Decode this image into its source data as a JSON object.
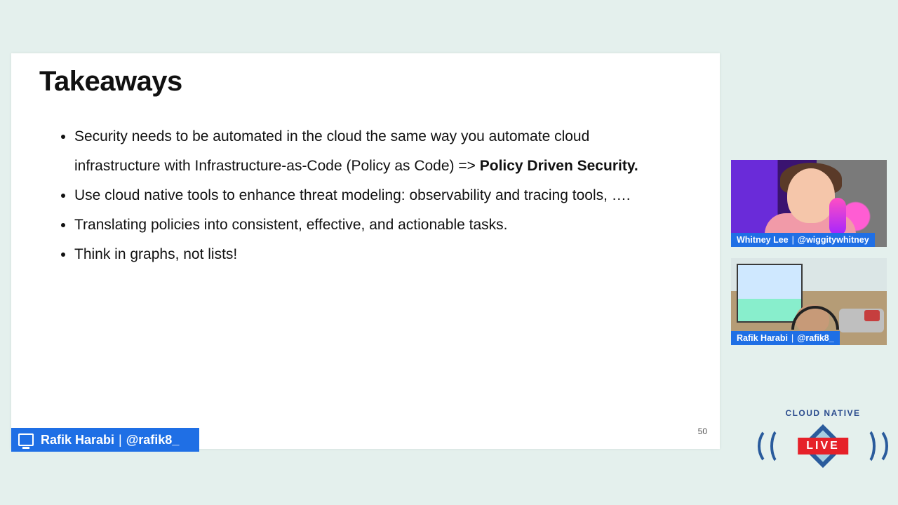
{
  "slide": {
    "title": "Takeaways",
    "bullet1_pre": "Security needs to be automated in the cloud the same way you automate cloud infrastructure with Infrastructure-as-Code (Policy as Code) => ",
    "bullet1_bold": "Policy Driven Security.",
    "bullet2": "Use cloud native tools to enhance threat modeling: observability and tracing tools, ….",
    "bullet3": "Translating policies into consistent, effective, and actionable tasks.",
    "bullet4": "Think in graphs, not lists!",
    "page_number": "50"
  },
  "presenter_bar": {
    "name": "Rafik Harabi",
    "handle": "@rafik8_"
  },
  "participants": [
    {
      "name": "Whitney Lee",
      "handle": "@wiggitywhitney"
    },
    {
      "name": "Rafik Harabi",
      "handle": "@rafik8_"
    }
  ],
  "logo": {
    "top_text": "CLOUD NATIVE",
    "badge": "LIVE"
  }
}
